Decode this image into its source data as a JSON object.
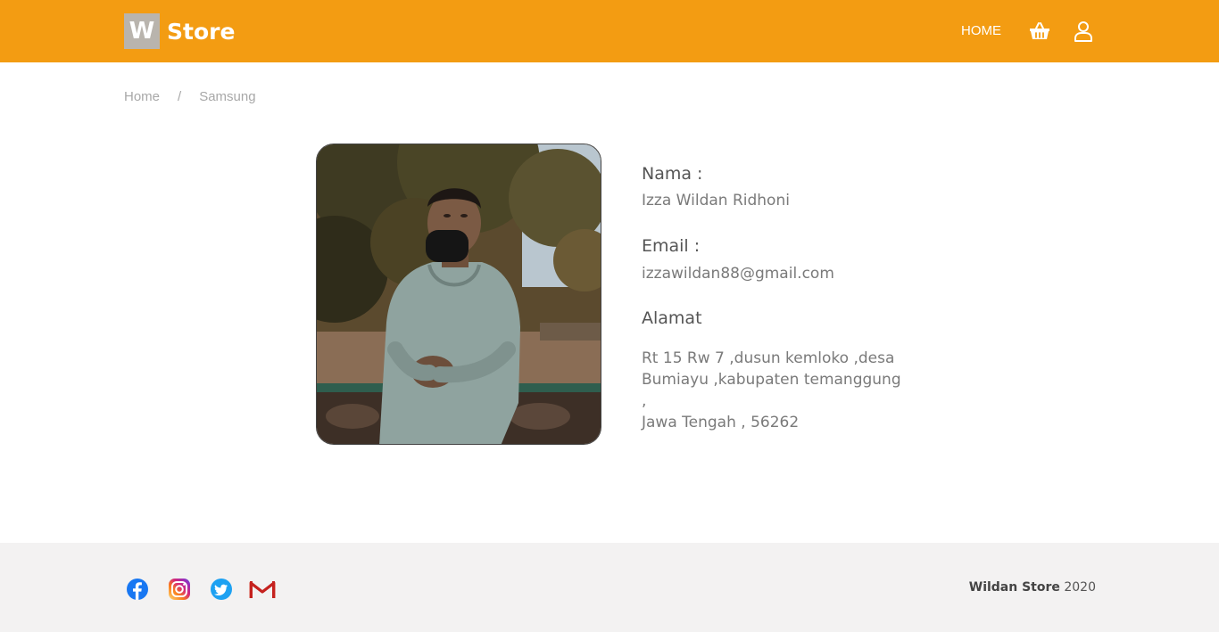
{
  "header": {
    "brand_letter": "W",
    "brand_name": "Store",
    "nav_home": "HOME",
    "cart_icon": "basket-icon",
    "user_icon": "user-icon",
    "color": "#f39c12"
  },
  "breadcrumb": {
    "items": [
      "Home",
      "Samsung"
    ],
    "separator": "/"
  },
  "profile": {
    "photo": "profile-photo",
    "nama_label": "Nama :",
    "nama_value": "Izza Wildan Ridhoni",
    "email_label": "Email :",
    "email_value": "izzawildan88@gmail.com",
    "alamat_label": "Alamat",
    "alamat_lines": [
      "Rt 15 Rw 7 ,dusun kemloko ,desa",
      "Bumiayu ,kabupaten temanggung ,",
      "Jawa Tengah , 56262"
    ]
  },
  "footer": {
    "social_icons": [
      "facebook-icon",
      "instagram-icon",
      "twitter-icon",
      "gmail-icon"
    ],
    "brand": "Wildan Store",
    "year": "2020",
    "background": "#f3f2f2"
  }
}
